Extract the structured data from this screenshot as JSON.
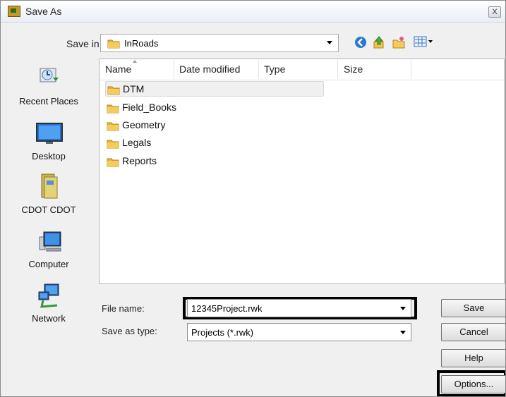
{
  "window": {
    "title": "Save As",
    "close_label": "X"
  },
  "save_in": {
    "label": "Save in:",
    "value": "InRoads"
  },
  "toolbar": {
    "icons": [
      "back-icon",
      "up-folder-icon",
      "new-folder-icon",
      "views-menu-icon"
    ]
  },
  "places": [
    {
      "label": "Recent Places",
      "icon": "recent-places-icon"
    },
    {
      "label": "Desktop",
      "icon": "desktop-icon"
    },
    {
      "label": "CDOT CDOT",
      "icon": "user-folder-icon"
    },
    {
      "label": "Computer",
      "icon": "computer-icon"
    },
    {
      "label": "Network",
      "icon": "network-icon"
    }
  ],
  "file_list": {
    "columns": [
      "Name",
      "Date modified",
      "Type",
      "Size"
    ],
    "items": [
      {
        "name": "DTM",
        "selected": true
      },
      {
        "name": "Field_Books",
        "selected": false
      },
      {
        "name": "Geometry",
        "selected": false
      },
      {
        "name": "Legals",
        "selected": false
      },
      {
        "name": "Reports",
        "selected": false
      }
    ]
  },
  "file_name": {
    "label": "File name:",
    "value": "12345Project.rwk"
  },
  "save_type": {
    "label": "Save as type:",
    "value": "Projects (*.rwk)"
  },
  "buttons": {
    "save": "Save",
    "cancel": "Cancel",
    "help": "Help",
    "options": "Options..."
  },
  "colors": {
    "folder": "#e8b84a",
    "highlight_border": "#000000",
    "dialog_bg": "#f0f0f0"
  }
}
